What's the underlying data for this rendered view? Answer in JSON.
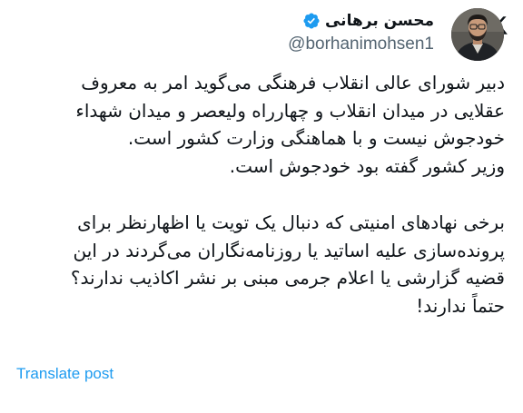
{
  "author": {
    "display_name": "محسن برهانی",
    "handle": "@borhanimohsen1",
    "verified": true,
    "verified_color": "#1d9bf0"
  },
  "icons": {
    "logo": "x-logo-icon",
    "verified": "verified-badge-icon"
  },
  "tweet": {
    "paragraph1_lines": [
      "دبیر شورای عالی انقلاب فرهنگی می‌گوید امر به معروف",
      "عقلایی در میدان انقلاب و چهارراه ولیعصر و میدان شهداء",
      "خودجوش نیست و با هماهنگی وزارت کشور است.",
      "وزیر کشور گفته بود خودجوش است."
    ],
    "paragraph2_lines": [
      "برخی نهادهای امنیتی که دنبال یک تویت یا اظهارنظر برای",
      "پرونده‌سازی علیه اساتید یا روزنامه‌نگاران می‌گردند در این",
      "قضیه گزارشی یا اعلام جرمی مبنی بر نشر اکاذیب ندارند؟",
      "حتماً ندارند!"
    ]
  },
  "translate_label": "Translate post",
  "colors": {
    "text": "#0f1419",
    "secondary": "#536471",
    "link": "#1d9bf0"
  }
}
